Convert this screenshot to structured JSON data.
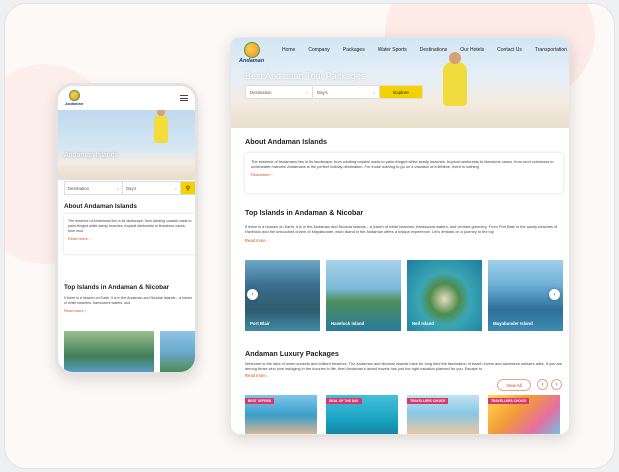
{
  "mobile": {
    "logo": "Andaman",
    "hero_title": "Andaman Islands",
    "search": {
      "destination": "Destination",
      "days": "Day's"
    },
    "about_title": "About Andaman Islands",
    "about_text": "The essence of Andamans lies in its landscape; from winding coastal roads to palm-fringed white sandy beaches, tropical rainforests to limestone caves, from mud",
    "read_more": "Read more",
    "islands_title": "Top Islands in Andaman & Nicobar",
    "islands_text": "If there is a heaven on Earth, it is in the Andaman and Nicobar Islands – a haven of white beaches, translucent waters, and",
    "islands_read_more": "Read more"
  },
  "desktop": {
    "logo": "Andaman",
    "nav": [
      "Home",
      "Company",
      "Packages",
      "Water Sports",
      "Destinations",
      "Our Hotels",
      "Contact Us",
      "Transportation"
    ],
    "hero_title": "Best Andaman Tour Packages",
    "search": {
      "destination": "Destination",
      "days": "Day's",
      "explore": "Explore"
    },
    "about_title": "About Andaman Islands",
    "about_text": "The essence of Andamans lies in its landscape; from winding coastal roads to palm-fringed white sandy beaches, tropical rainforests to limestone caves, from mud volcanoes to underwater marvels! Andamans is the perfect holiday destination. For those wishing to go on a vacation of a lifetime, there is nothing",
    "read_more": "Readmore",
    "islands_title": "Top Islands in Andaman & Nicobar",
    "islands_text": "If there is a heaven on Earth, it is in the Andaman and Nicobar Islands – a haven of white beaches, translucent waters, and verdant greenery. From Port Blair to the sandy beaches of Havelock and the untouched charm of Mayabunder, each island in the Andaman offers a unique experience. Let's embark on a journey to the top",
    "islands_read_more": "Read more",
    "islands": [
      {
        "name": "Port Blair"
      },
      {
        "name": "Havelock Island"
      },
      {
        "name": "Neil Island"
      },
      {
        "name": "Mayabunder Island"
      }
    ],
    "luxury_title": "Andaman Luxury Packages",
    "luxury_text": "Welcome to the land of warm sunsets and brilliant beaches. The Andaman and Nicobar Islands have for long held the fascination of beach lovers and adventure seekers alike. If you are among those who love indulging in the luxuries in life, then Andaman's island travels has just the right vacation planned for you. Escape to",
    "luxury_read_more": "Read more",
    "view_all": "View All",
    "packages": [
      {
        "tag": "BEST OFFERS"
      },
      {
        "tag": "DEAL OF THE DAY"
      },
      {
        "tag": "TRAVELLERS CHOICE"
      },
      {
        "tag": "TRAVELLERS CHOICE"
      }
    ]
  },
  "colors": {
    "accent": "#f3d200",
    "link": "#e04b1e",
    "tag": "#d6376c"
  }
}
